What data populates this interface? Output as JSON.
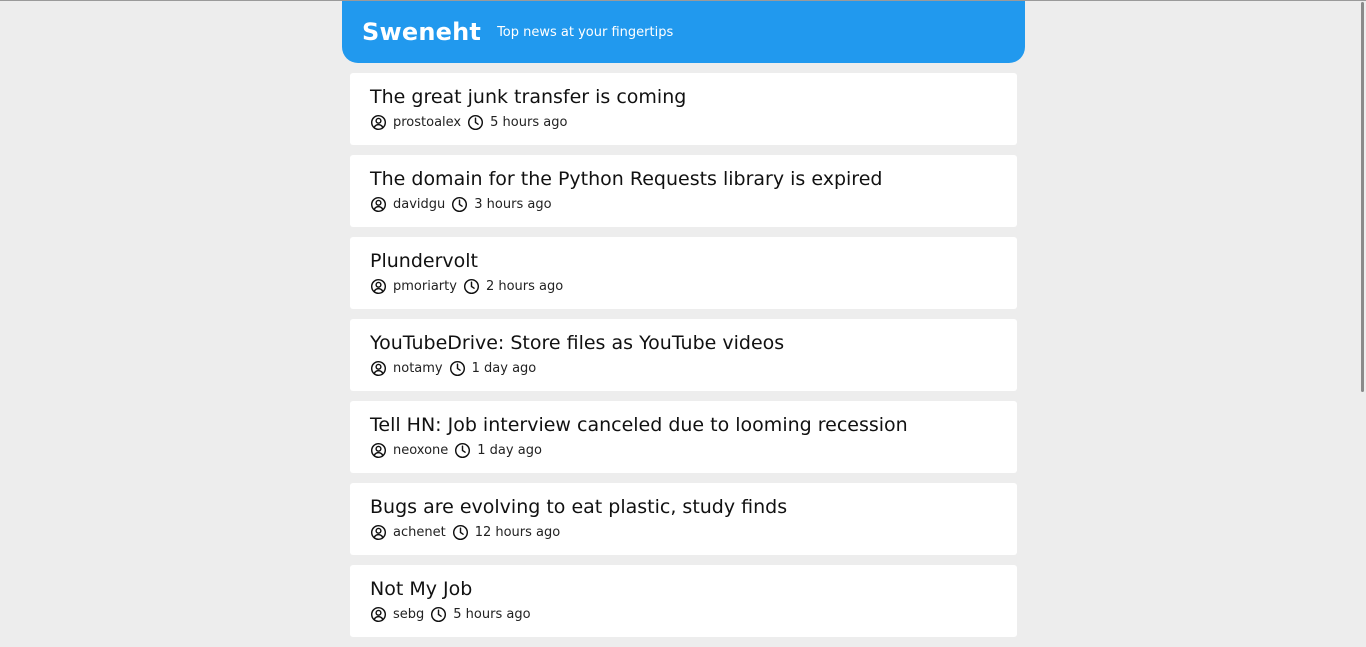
{
  "header": {
    "brand": "Sweneht",
    "tagline": "Top news at your fingertips",
    "background_color": "#2199ee"
  },
  "stories": [
    {
      "title": "The great junk transfer is coming",
      "author": "prostoalex",
      "time": "5 hours ago"
    },
    {
      "title": "The domain for the Python Requests library is expired",
      "author": "davidgu",
      "time": "3 hours ago"
    },
    {
      "title": "Plundervolt",
      "author": "pmoriarty",
      "time": "2 hours ago"
    },
    {
      "title": "YouTubeDrive: Store files as YouTube videos",
      "author": "notamy",
      "time": "1 day ago"
    },
    {
      "title": "Tell HN: Job interview canceled due to looming recession",
      "author": "neoxone",
      "time": "1 day ago"
    },
    {
      "title": "Bugs are evolving to eat plastic, study finds",
      "author": "achenet",
      "time": "12 hours ago"
    },
    {
      "title": "Not My Job",
      "author": "sebg",
      "time": "5 hours ago"
    }
  ],
  "icons": {
    "author": "user-circle-icon",
    "time": "clock-icon"
  }
}
